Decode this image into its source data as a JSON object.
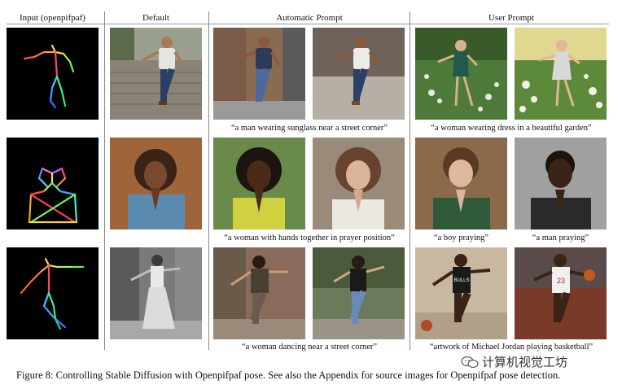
{
  "headers": {
    "input": "Input (openpifpaf)",
    "default": "Default",
    "automatic": "Automatic Prompt",
    "user": "User Prompt"
  },
  "captions": {
    "row1_auto": "“a man wearing sunglass near a street corner”",
    "row1_user": "“a woman wearing dress in a beautiful garden”",
    "row2_auto": "“a woman with hands together in prayer position”",
    "row2_user_a": "“a boy praying”",
    "row2_user_b": "“a man praying”",
    "row3_auto": "“a woman dancing near a street corner”",
    "row3_user": "“artwork of Michael Jordan playing basketball”"
  },
  "jersey_number": "23",
  "jersey_text": "BULLS",
  "figure_caption": "Figure 8: Controlling Stable Diffusion with Openpifpaf pose. See also the Appendix for source images for Openpifpaf pose detection.",
  "watermark": "计算机视觉工坊",
  "colors": {
    "pose_background": "#000000",
    "separator": "#888888"
  }
}
